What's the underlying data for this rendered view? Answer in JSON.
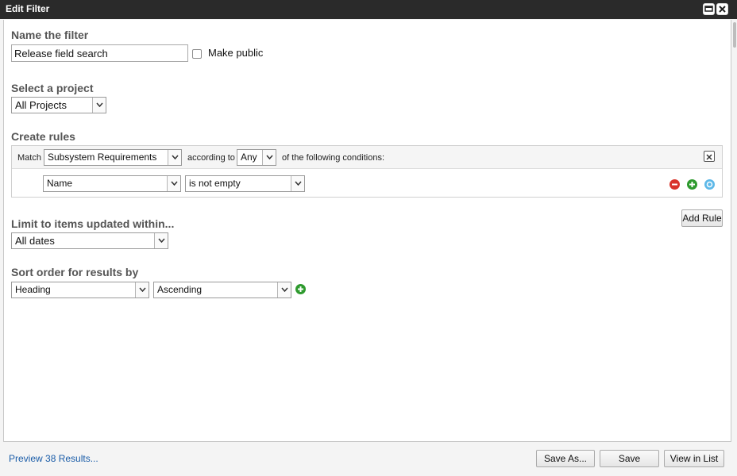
{
  "window": {
    "title": "Edit Filter",
    "minimize_icon": "minimize-icon",
    "close_icon": "close-icon"
  },
  "name_section": {
    "label": "Name the filter",
    "value": "Release field search",
    "make_public_label": "Make public",
    "make_public_checked": false
  },
  "project_section": {
    "label": "Select a project",
    "selected": "All Projects"
  },
  "rules_section": {
    "label": "Create rules",
    "match_label": "Match",
    "match_selected": "Subsystem Requirements",
    "according_label": "according to",
    "any_selected": "Any",
    "conditions_label": "of the following conditions:",
    "rule": {
      "field": "Name",
      "operator": "is not empty"
    },
    "add_rule_label": "Add Rule",
    "colors": {
      "remove": "#d9332a",
      "add": "#2e9a2e",
      "info": "#5db8e8"
    }
  },
  "limit_section": {
    "label": "Limit to items updated within...",
    "selected": "All dates"
  },
  "sort_section": {
    "label": "Sort order for results by",
    "field_selected": "Heading",
    "order_selected": "Ascending"
  },
  "footer": {
    "preview_label": "Preview 38 Results...",
    "save_as_label": "Save As...",
    "save_label": "Save",
    "view_in_list_label": "View in List"
  },
  "colors": {
    "titlebar": "#2a2a2a",
    "link": "#1a5ca8"
  }
}
